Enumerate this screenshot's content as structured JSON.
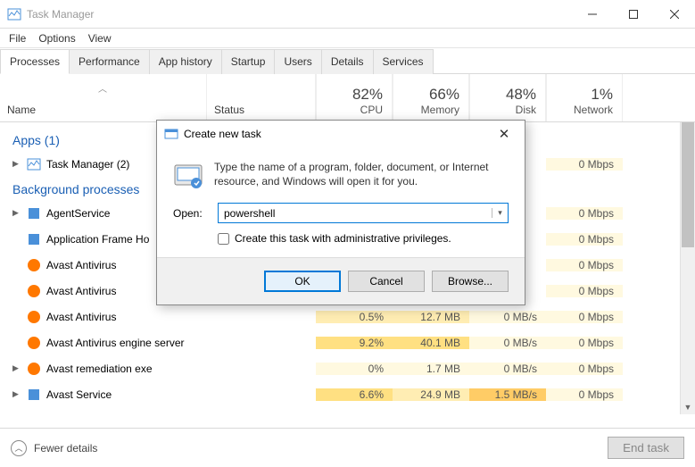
{
  "window": {
    "title": "Task Manager"
  },
  "menu": {
    "file": "File",
    "options": "Options",
    "view": "View"
  },
  "tabs": {
    "processes": "Processes",
    "performance": "Performance",
    "apphistory": "App history",
    "startup": "Startup",
    "users": "Users",
    "details": "Details",
    "services": "Services"
  },
  "columns": {
    "name": "Name",
    "status": "Status",
    "cpu": {
      "pct": "82%",
      "label": "CPU"
    },
    "memory": {
      "pct": "66%",
      "label": "Memory"
    },
    "disk": {
      "pct": "48%",
      "label": "Disk"
    },
    "network": {
      "pct": "1%",
      "label": "Network"
    }
  },
  "groups": {
    "apps": "Apps (1)",
    "bg": "Background processes"
  },
  "rows": [
    {
      "name": "Task Manager (2)",
      "net": "0 Mbps"
    },
    {
      "name": "AgentService",
      "net": "0 Mbps"
    },
    {
      "name": "Application Frame Ho",
      "net": "0 Mbps"
    },
    {
      "name": "Avast Antivirus",
      "net": "0 Mbps"
    },
    {
      "name": "Avast Antivirus",
      "net": "0 Mbps"
    },
    {
      "name": "Avast Antivirus",
      "cpu": "0.5%",
      "mem": "12.7 MB",
      "disk": "0 MB/s",
      "net": "0 Mbps"
    },
    {
      "name": "Avast Antivirus engine server",
      "cpu": "9.2%",
      "mem": "40.1 MB",
      "disk": "0 MB/s",
      "net": "0 Mbps"
    },
    {
      "name": "Avast remediation exe",
      "cpu": "0%",
      "mem": "1.7 MB",
      "disk": "0 MB/s",
      "net": "0 Mbps"
    },
    {
      "name": "Avast Service",
      "cpu": "6.6%",
      "mem": "24.9 MB",
      "disk": "1.5 MB/s",
      "net": "0 Mbps"
    }
  ],
  "footer": {
    "fewer": "Fewer details",
    "endtask": "End task"
  },
  "dialog": {
    "title": "Create new task",
    "message": "Type the name of a program, folder, document, or Internet resource, and Windows will open it for you.",
    "open_label": "Open:",
    "open_value": "powershell",
    "admin_label": "Create this task with administrative privileges.",
    "ok": "OK",
    "cancel": "Cancel",
    "browse": "Browse..."
  }
}
